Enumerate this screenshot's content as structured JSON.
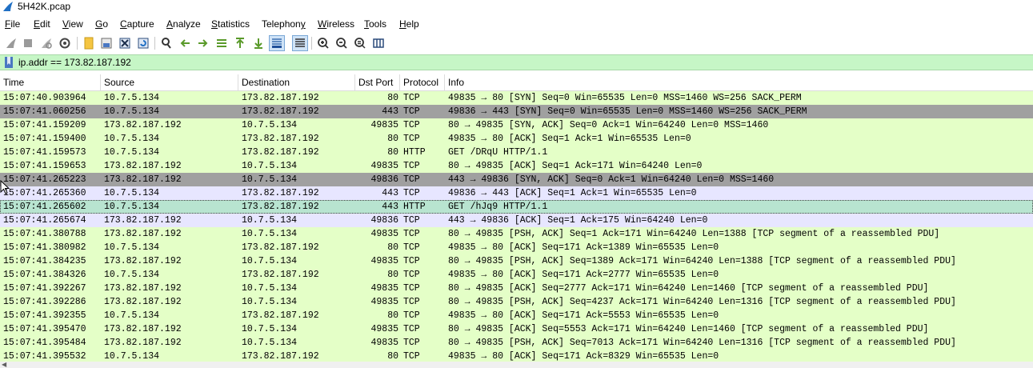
{
  "window": {
    "title": "5H42K.pcap",
    "accent": "#1f6fc4"
  },
  "menu": [
    {
      "label": "File",
      "mnemonic": "F",
      "rest": "ile"
    },
    {
      "label": "Edit",
      "mnemonic": "E",
      "rest": "dit"
    },
    {
      "label": "View",
      "mnemonic": "V",
      "rest": "iew"
    },
    {
      "label": "Go",
      "mnemonic": "G",
      "rest": "o"
    },
    {
      "label": "Capture",
      "mnemonic": "C",
      "rest": "apture"
    },
    {
      "label": "Analyze",
      "mnemonic": "A",
      "rest": "nalyze"
    },
    {
      "label": "Statistics",
      "mnemonic": "S",
      "rest": "tatistics"
    },
    {
      "label": "Telephony",
      "mnemonic": "",
      "rest": "Telephon",
      "tail": "y",
      "tailUnderline": true
    },
    {
      "label": "Wireless",
      "mnemonic": "W",
      "rest": "ireless"
    },
    {
      "label": "Tools",
      "mnemonic": "T",
      "rest": "ools"
    },
    {
      "label": "Help",
      "mnemonic": "H",
      "rest": "elp"
    }
  ],
  "toolbar": {
    "icons": [
      "shark-fin-start-icon",
      "stop-capture-icon",
      "restart-capture-icon",
      "capture-options-icon",
      "open-file-icon",
      "save-file-icon",
      "close-file-icon",
      "reload-file-icon",
      "find-packet-icon",
      "go-back-icon",
      "go-forward-icon",
      "go-to-packet-icon",
      "go-first-packet-icon",
      "go-last-packet-icon",
      "autoscroll-icon",
      "colorize-icon",
      "zoom-in-icon",
      "zoom-out-icon",
      "zoom-normal-icon",
      "resize-columns-icon"
    ]
  },
  "filter": {
    "value": "ip.addr == 173.82.187.192",
    "background": "#c6f6c6"
  },
  "columns": {
    "time": "Time",
    "source": "Source",
    "destination": "Destination",
    "dst_port": "Dst Port",
    "protocol": "Protocol",
    "info": "Info"
  },
  "colors": {
    "tcp_green": "#e4ffc7",
    "grey_syn": "#a0a0a0",
    "lavender": "#e7e6ff",
    "http_selected": "#b8e4d0"
  },
  "packets": [
    {
      "time": "15:07:40.903964",
      "src": "10.7.5.134",
      "dst": "173.82.187.192",
      "port": "80",
      "proto": "TCP",
      "info": "49835 → 80 [SYN] Seq=0 Win=65535 Len=0 MSS=1460 WS=256 SACK_PERM",
      "bg": "#e4ffc7"
    },
    {
      "time": "15:07:41.060256",
      "src": "10.7.5.134",
      "dst": "173.82.187.192",
      "port": "443",
      "proto": "TCP",
      "info": "49836 → 443 [SYN] Seq=0 Win=65535 Len=0 MSS=1460 WS=256 SACK_PERM",
      "bg": "#a0a0a0"
    },
    {
      "time": "15:07:41.159209",
      "src": "173.82.187.192",
      "dst": "10.7.5.134",
      "port": "49835",
      "proto": "TCP",
      "info": "80 → 49835 [SYN, ACK] Seq=0 Ack=1 Win=64240 Len=0 MSS=1460",
      "bg": "#e4ffc7"
    },
    {
      "time": "15:07:41.159400",
      "src": "10.7.5.134",
      "dst": "173.82.187.192",
      "port": "80",
      "proto": "TCP",
      "info": "49835 → 80 [ACK] Seq=1 Ack=1 Win=65535 Len=0",
      "bg": "#e4ffc7"
    },
    {
      "time": "15:07:41.159573",
      "src": "10.7.5.134",
      "dst": "173.82.187.192",
      "port": "80",
      "proto": "HTTP",
      "info": "GET /DRqU HTTP/1.1",
      "bg": "#e4ffc7"
    },
    {
      "time": "15:07:41.159653",
      "src": "173.82.187.192",
      "dst": "10.7.5.134",
      "port": "49835",
      "proto": "TCP",
      "info": "80 → 49835 [ACK] Seq=1 Ack=171 Win=64240 Len=0",
      "bg": "#e4ffc7"
    },
    {
      "time": "15:07:41.265223",
      "src": "173.82.187.192",
      "dst": "10.7.5.134",
      "port": "49836",
      "proto": "TCP",
      "info": "443 → 49836 [SYN, ACK] Seq=0 Ack=1 Win=64240 Len=0 MSS=1460",
      "bg": "#a0a0a0"
    },
    {
      "time": "15:07:41.265360",
      "src": "10.7.5.134",
      "dst": "173.82.187.192",
      "port": "443",
      "proto": "TCP",
      "info": "49836 → 443 [ACK] Seq=1 Ack=1 Win=65535 Len=0",
      "bg": "#e7e6ff"
    },
    {
      "time": "15:07:41.265602",
      "src": "10.7.5.134",
      "dst": "173.82.187.192",
      "port": "443",
      "proto": "HTTP",
      "info": "GET /hJq9 HTTP/1.1",
      "bg": "#b8e4d0",
      "outline": true
    },
    {
      "time": "15:07:41.265674",
      "src": "173.82.187.192",
      "dst": "10.7.5.134",
      "port": "49836",
      "proto": "TCP",
      "info": "443 → 49836 [ACK] Seq=1 Ack=175 Win=64240 Len=0",
      "bg": "#e7e6ff"
    },
    {
      "time": "15:07:41.380788",
      "src": "173.82.187.192",
      "dst": "10.7.5.134",
      "port": "49835",
      "proto": "TCP",
      "info": "80 → 49835 [PSH, ACK] Seq=1 Ack=171 Win=64240 Len=1388 [TCP segment of a reassembled PDU]",
      "bg": "#e4ffc7"
    },
    {
      "time": "15:07:41.380982",
      "src": "10.7.5.134",
      "dst": "173.82.187.192",
      "port": "80",
      "proto": "TCP",
      "info": "49835 → 80 [ACK] Seq=171 Ack=1389 Win=65535 Len=0",
      "bg": "#e4ffc7"
    },
    {
      "time": "15:07:41.384235",
      "src": "173.82.187.192",
      "dst": "10.7.5.134",
      "port": "49835",
      "proto": "TCP",
      "info": "80 → 49835 [PSH, ACK] Seq=1389 Ack=171 Win=64240 Len=1388 [TCP segment of a reassembled PDU]",
      "bg": "#e4ffc7"
    },
    {
      "time": "15:07:41.384326",
      "src": "10.7.5.134",
      "dst": "173.82.187.192",
      "port": "80",
      "proto": "TCP",
      "info": "49835 → 80 [ACK] Seq=171 Ack=2777 Win=65535 Len=0",
      "bg": "#e4ffc7"
    },
    {
      "time": "15:07:41.392267",
      "src": "173.82.187.192",
      "dst": "10.7.5.134",
      "port": "49835",
      "proto": "TCP",
      "info": "80 → 49835 [ACK] Seq=2777 Ack=171 Win=64240 Len=1460 [TCP segment of a reassembled PDU]",
      "bg": "#e4ffc7"
    },
    {
      "time": "15:07:41.392286",
      "src": "173.82.187.192",
      "dst": "10.7.5.134",
      "port": "49835",
      "proto": "TCP",
      "info": "80 → 49835 [PSH, ACK] Seq=4237 Ack=171 Win=64240 Len=1316 [TCP segment of a reassembled PDU]",
      "bg": "#e4ffc7"
    },
    {
      "time": "15:07:41.392355",
      "src": "10.7.5.134",
      "dst": "173.82.187.192",
      "port": "80",
      "proto": "TCP",
      "info": "49835 → 80 [ACK] Seq=171 Ack=5553 Win=65535 Len=0",
      "bg": "#e4ffc7"
    },
    {
      "time": "15:07:41.395470",
      "src": "173.82.187.192",
      "dst": "10.7.5.134",
      "port": "49835",
      "proto": "TCP",
      "info": "80 → 49835 [ACK] Seq=5553 Ack=171 Win=64240 Len=1460 [TCP segment of a reassembled PDU]",
      "bg": "#e4ffc7"
    },
    {
      "time": "15:07:41.395484",
      "src": "173.82.187.192",
      "dst": "10.7.5.134",
      "port": "49835",
      "proto": "TCP",
      "info": "80 → 49835 [PSH, ACK] Seq=7013 Ack=171 Win=64240 Len=1316 [TCP segment of a reassembled PDU]",
      "bg": "#e4ffc7"
    },
    {
      "time": "15:07:41.395532",
      "src": "10.7.5.134",
      "dst": "173.82.187.192",
      "port": "80",
      "proto": "TCP",
      "info": "49835 → 80 [ACK] Seq=171 Ack=8329 Win=65535 Len=0",
      "bg": "#e4ffc7"
    }
  ]
}
